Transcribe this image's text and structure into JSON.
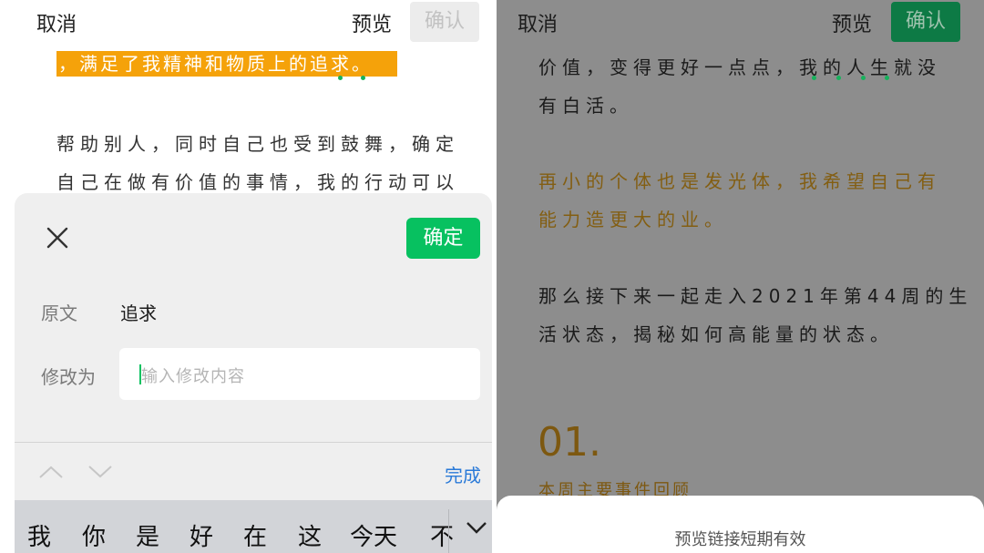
{
  "left": {
    "topbar": {
      "cancel": "取消",
      "preview": "预览",
      "confirm": "确认"
    },
    "article": {
      "highlighted": "，满足了我精神和物质上的追求。",
      "lines": [
        "帮助别人，同时自己也受到鼓舞，确定",
        "自己在做有价值的事情，我的行动可以"
      ]
    },
    "sheet": {
      "ok": "确定",
      "original_label": "原文",
      "original_value": "追求",
      "modify_label": "修改为",
      "modify_placeholder": "输入修改内容",
      "done": "完成",
      "candidates": [
        "我",
        "你",
        "是",
        "好",
        "在",
        "这",
        "今天",
        "不"
      ]
    }
  },
  "right": {
    "topbar": {
      "cancel": "取消",
      "preview": "预览",
      "confirm": "确认"
    },
    "article": {
      "lines": [
        "价值，变得更好一点点，我的人生就没",
        "有白活。",
        "再小的个体也是发光体，我希望自己有",
        "能力造更大的业。",
        "那么接下来一起走入2021年第44周的生",
        "活状态，揭秘如何高能量的状态。"
      ],
      "section_number": "01.",
      "section_title": "本周主要事件回顾"
    },
    "sheet_note": "预览链接短期有效"
  },
  "colors": {
    "accent_green": "#07c160",
    "highlight": "#f5a20a",
    "link_blue": "#2a7ad8"
  },
  "icons": [
    "close-icon",
    "chevron-up-icon",
    "chevron-down-icon",
    "keyboard-collapse-icon"
  ]
}
